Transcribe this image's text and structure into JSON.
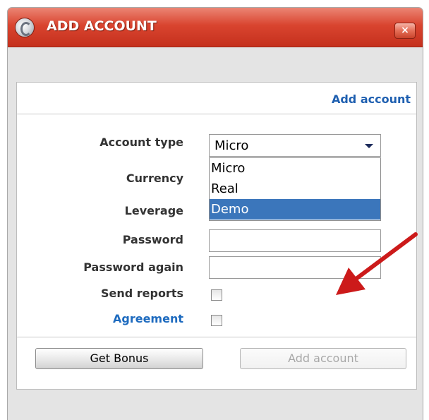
{
  "window": {
    "title": "ADD ACCOUNT",
    "close_label": "×"
  },
  "header": {
    "link_text": "Add account"
  },
  "form": {
    "account_type": {
      "label": "Account type",
      "value": "Micro",
      "options": [
        "Micro",
        "Real",
        "Demo"
      ],
      "highlighted_option": "Demo"
    },
    "currency": {
      "label": "Currency"
    },
    "leverage": {
      "label": "Leverage"
    },
    "password": {
      "label": "Password",
      "value": ""
    },
    "password_again": {
      "label": "Password again",
      "value": ""
    },
    "send_reports": {
      "label": "Send reports",
      "checked": false
    },
    "agreement": {
      "label": "Agreement",
      "checked": false
    }
  },
  "buttons": {
    "get_bonus": "Get Bonus",
    "add_account": "Add account"
  },
  "colors": {
    "titlebar": "#d9442f",
    "link_blue": "#1e5fb0",
    "selection_blue": "#3b76bb",
    "arrow_red": "#cc1a1a"
  },
  "icons": {
    "logo": "app-logo-icon",
    "close": "close-icon",
    "dropdown": "chevron-down-icon",
    "annotation": "red-arrow-icon"
  }
}
